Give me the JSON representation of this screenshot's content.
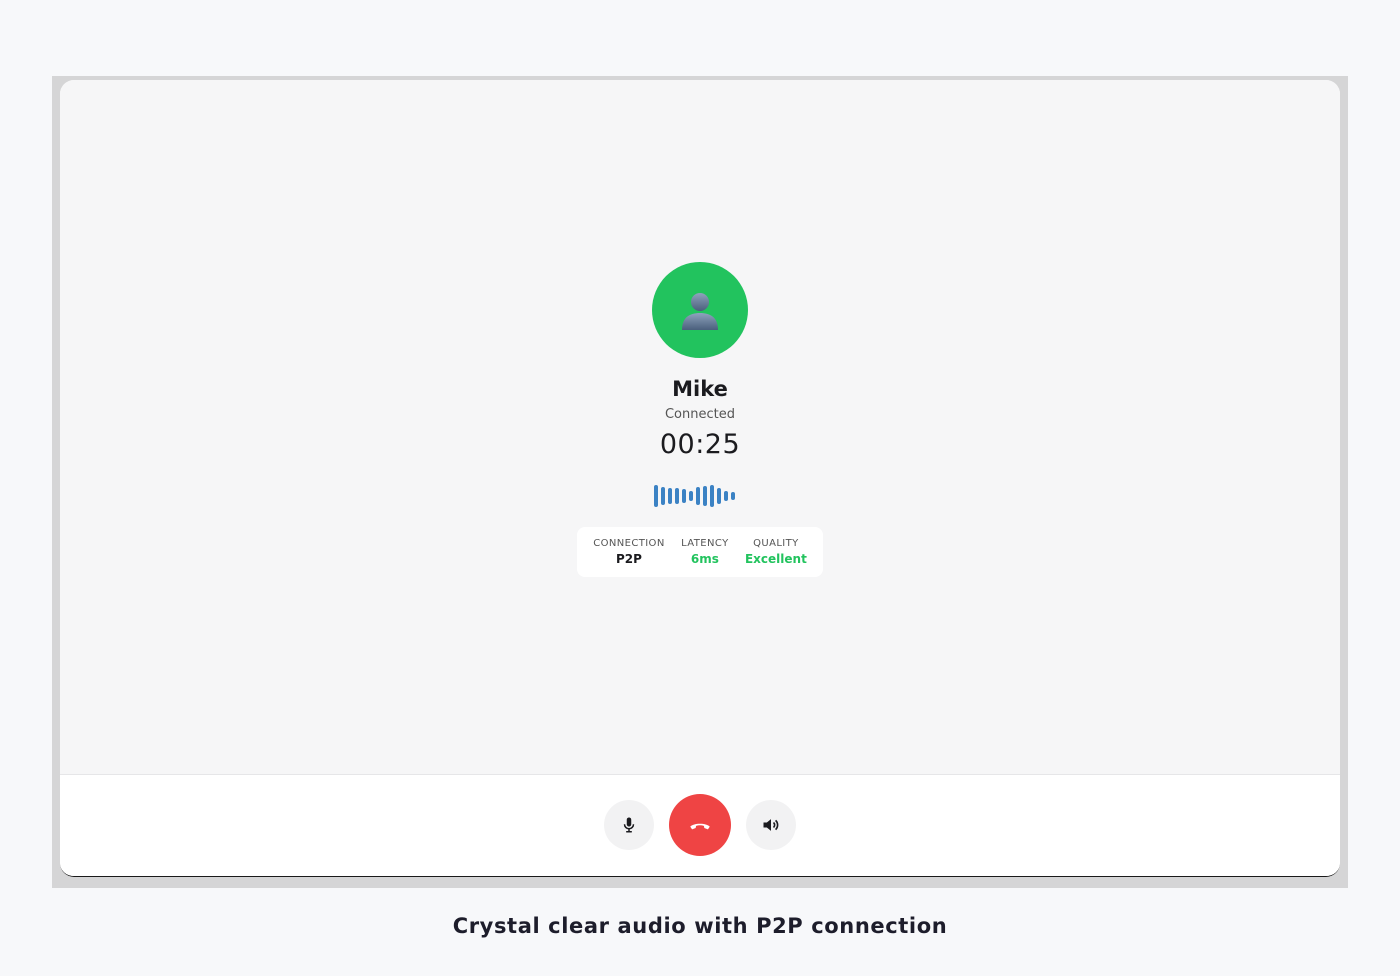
{
  "contact": {
    "name": "Mike",
    "status": "Connected",
    "duration": "00:25",
    "avatar_icon": "person-silhouette-icon"
  },
  "stats": [
    {
      "label": "CONNECTION",
      "value": "P2P",
      "color": "#1b1b1f"
    },
    {
      "label": "LATENCY",
      "value": "6ms",
      "color": "#22c35e"
    },
    {
      "label": "QUALITY",
      "value": "Excellent",
      "color": "#22c35e"
    }
  ],
  "controls": {
    "mute_icon": "microphone-icon",
    "end_icon": "phone-hangup-icon",
    "speaker_icon": "speaker-icon"
  },
  "colors": {
    "accent_green": "#22c35e",
    "end_call_red": "#ef4444",
    "waveform_blue": "#3b82c4"
  },
  "caption": "Crystal clear audio with P2P connection"
}
